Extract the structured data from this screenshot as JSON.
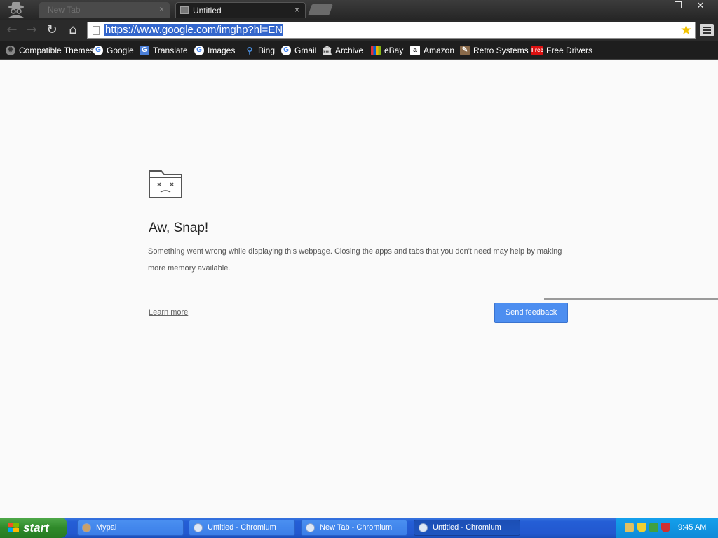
{
  "browser": {
    "tabs": [
      {
        "label": "New Tab",
        "active": false
      },
      {
        "label": "Untitled",
        "active": true
      }
    ],
    "close_glyph": "×",
    "window_controls": {
      "minimize": "–",
      "maximize": "❐",
      "close": "✕"
    },
    "url": "https://www.google.com/imghp?hl=EN",
    "nav": {
      "back": "←",
      "forward": "→",
      "reload": "↻",
      "home": "⌂"
    },
    "star": "★"
  },
  "bookmarks": [
    {
      "label": "Compatible Themes",
      "icon": "gear-icon"
    },
    {
      "label": "Google",
      "icon": "google-icon"
    },
    {
      "label": "Translate",
      "icon": "translate-icon"
    },
    {
      "label": "Images",
      "icon": "google-icon"
    },
    {
      "label": "Bing",
      "icon": "search-icon"
    },
    {
      "label": "Gmail",
      "icon": "google-icon"
    },
    {
      "label": "Archive",
      "icon": "archive-icon"
    },
    {
      "label": "eBay",
      "icon": "ebay-icon"
    },
    {
      "label": "Amazon",
      "icon": "amazon-icon"
    },
    {
      "label": "Retro Systems",
      "icon": "retro-icon"
    },
    {
      "label": "Free Drivers",
      "icon": "free-icon",
      "badge": "Free"
    }
  ],
  "error_page": {
    "title": "Aw, Snap!",
    "message": "Something went wrong while displaying this webpage. Closing the apps and tabs that you don't need may help by making more memory available.",
    "learn_more": "Learn more",
    "send_feedback": "Send feedback"
  },
  "taskbar": {
    "start": "start",
    "tasks": [
      {
        "label": "Mypal",
        "active": false
      },
      {
        "label": "Untitled - Chromium",
        "active": false
      },
      {
        "label": "New Tab - Chromium",
        "active": false
      },
      {
        "label": "Untitled - Chromium",
        "active": true
      }
    ],
    "clock": "9:45 AM"
  },
  "colors": {
    "url_highlight": "#3366cc",
    "feedback_button": "#4d8ef0",
    "taskbar_blue": "#245ed6",
    "start_green": "#2f8a2a"
  }
}
